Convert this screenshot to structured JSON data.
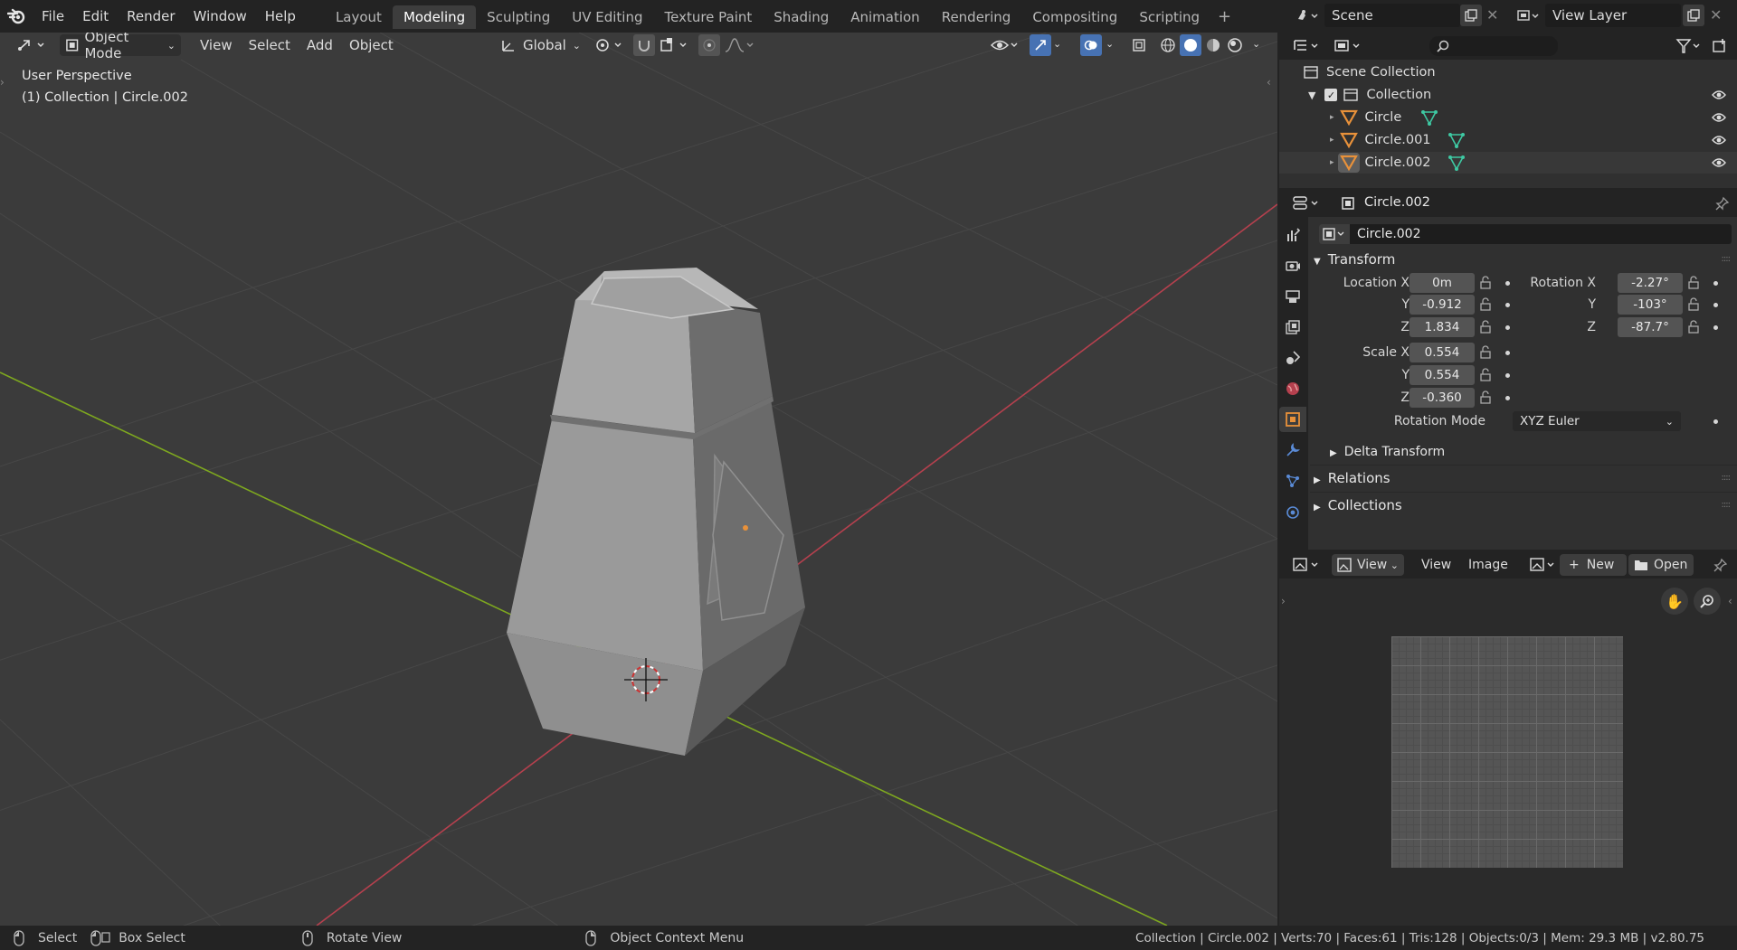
{
  "menubar": {
    "items": [
      "File",
      "Edit",
      "Render",
      "Window",
      "Help"
    ],
    "workspaces": [
      "Layout",
      "Modeling",
      "Sculpting",
      "UV Editing",
      "Texture Paint",
      "Shading",
      "Animation",
      "Rendering",
      "Compositing",
      "Scripting"
    ],
    "active_workspace": "Modeling",
    "scene": "Scene",
    "view_layer": "View Layer"
  },
  "viewport": {
    "mode": "Object Mode",
    "menus": [
      "View",
      "Select",
      "Add",
      "Object"
    ],
    "transform_orientation": "Global",
    "info_line1": "User Perspective",
    "info_line2": "(1) Collection | Circle.002"
  },
  "outliner": {
    "root": "Scene Collection",
    "collection": "Collection",
    "objects": [
      "Circle",
      "Circle.001",
      "Circle.002"
    ]
  },
  "properties": {
    "header_object": "Circle.002",
    "name_field": "Circle.002",
    "transform_title": "Transform",
    "location_label": "Location X",
    "rotation_label": "Rotation X",
    "scale_label": "Scale X",
    "y": "Y",
    "z": "Z",
    "location": [
      "0m",
      "-0.912",
      "1.834"
    ],
    "rotation": [
      "-2.27°",
      "-103°",
      "-87.7°"
    ],
    "scale": [
      "0.554",
      "0.554",
      "-0.360"
    ],
    "rotation_mode_label": "Rotation Mode",
    "rotation_mode": "XYZ Euler",
    "delta": "Delta Transform",
    "relations": "Relations",
    "collections": "Collections"
  },
  "image_editor": {
    "view_menu": "View",
    "menus": [
      "View",
      "Image"
    ],
    "new_label": "New",
    "open_label": "Open"
  },
  "statusbar": {
    "select": "Select",
    "box_select": "Box Select",
    "rotate_view": "Rotate View",
    "context_menu": "Object Context Menu",
    "stats": "Collection | Circle.002 | Verts:70 | Faces:61 | Tris:128 | Objects:0/3 | Mem: 29.3 MB | v2.80.75"
  },
  "colors": {
    "accent_blue": "#4772b3",
    "object_orange": "#e8913a",
    "mesh_green": "#3ec9a3",
    "x_axis_red": "#b5404e",
    "y_axis_green": "#7ea81f"
  }
}
